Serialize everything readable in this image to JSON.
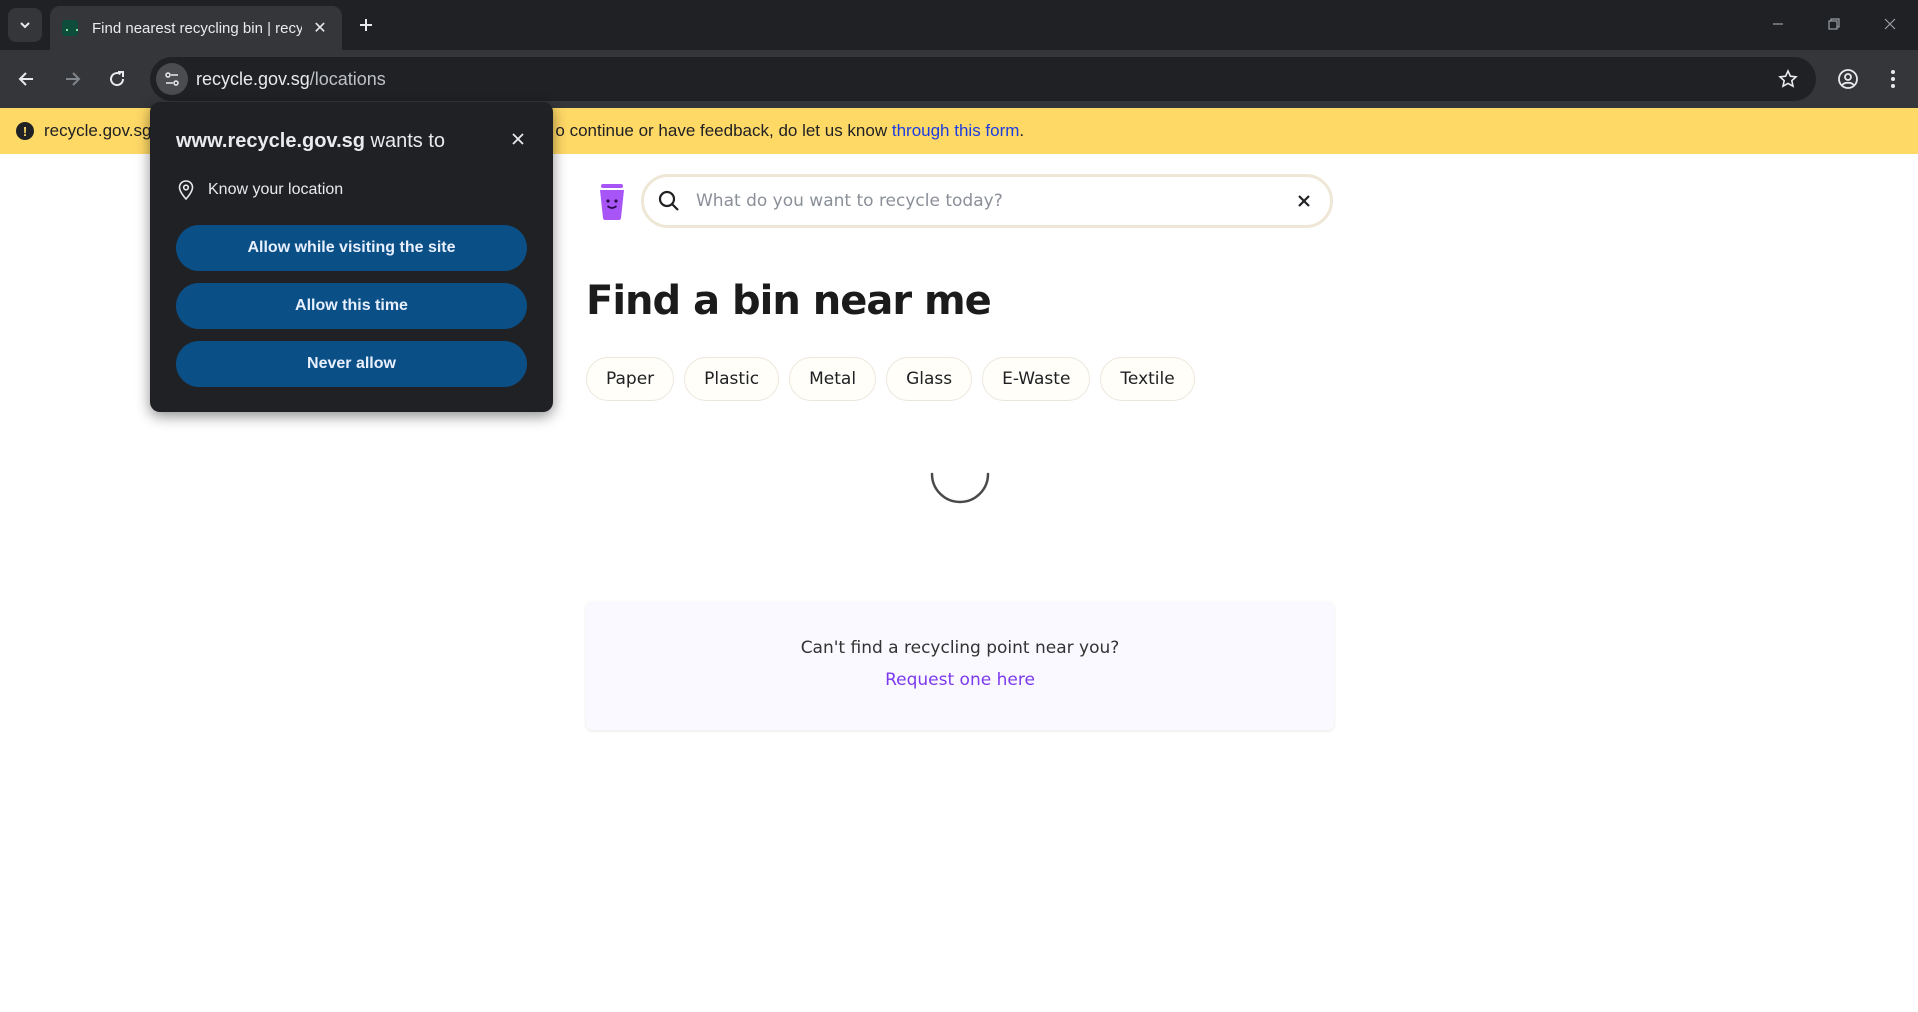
{
  "browser": {
    "tab": {
      "title": "Find nearest recycling bin | recycle.gov.sg"
    },
    "address": {
      "host": "recycle.gov.sg",
      "path": "/locations"
    }
  },
  "banner": {
    "text_prefix": "recycle.gov.sg",
    "text_middle": "o continue or have feedback, do let us know ",
    "link": "through this form",
    "text_suffix": "."
  },
  "permission_popup": {
    "site": "www.recycle.gov.sg",
    "wants_to": " wants to",
    "permission": "Know your location",
    "buttons": {
      "allow_visit": "Allow while visiting the site",
      "allow_once": "Allow this time",
      "never": "Never allow"
    }
  },
  "search": {
    "placeholder": "What do you want to recycle today?",
    "value": ""
  },
  "page": {
    "title": "Find a bin near me"
  },
  "categories": [
    "Paper",
    "Plastic",
    "Metal",
    "Glass",
    "E-Waste",
    "Textile"
  ],
  "request": {
    "question": "Can't find a recycling point near you?",
    "link": "Request one here"
  },
  "colors": {
    "banner": "#ffd966",
    "accent": "#7c3aed",
    "popup_button": "#0b4f87",
    "logo": "#a855f7"
  },
  "icons": [
    "tab-search-icon",
    "favicon",
    "close-icon",
    "plus-icon",
    "back-icon",
    "forward-icon",
    "reload-icon",
    "site-info-icon",
    "star-icon",
    "profile-icon",
    "menu-icon",
    "alert-icon",
    "location-pin-icon",
    "bin-logo-icon",
    "search-icon",
    "spinner-icon"
  ]
}
